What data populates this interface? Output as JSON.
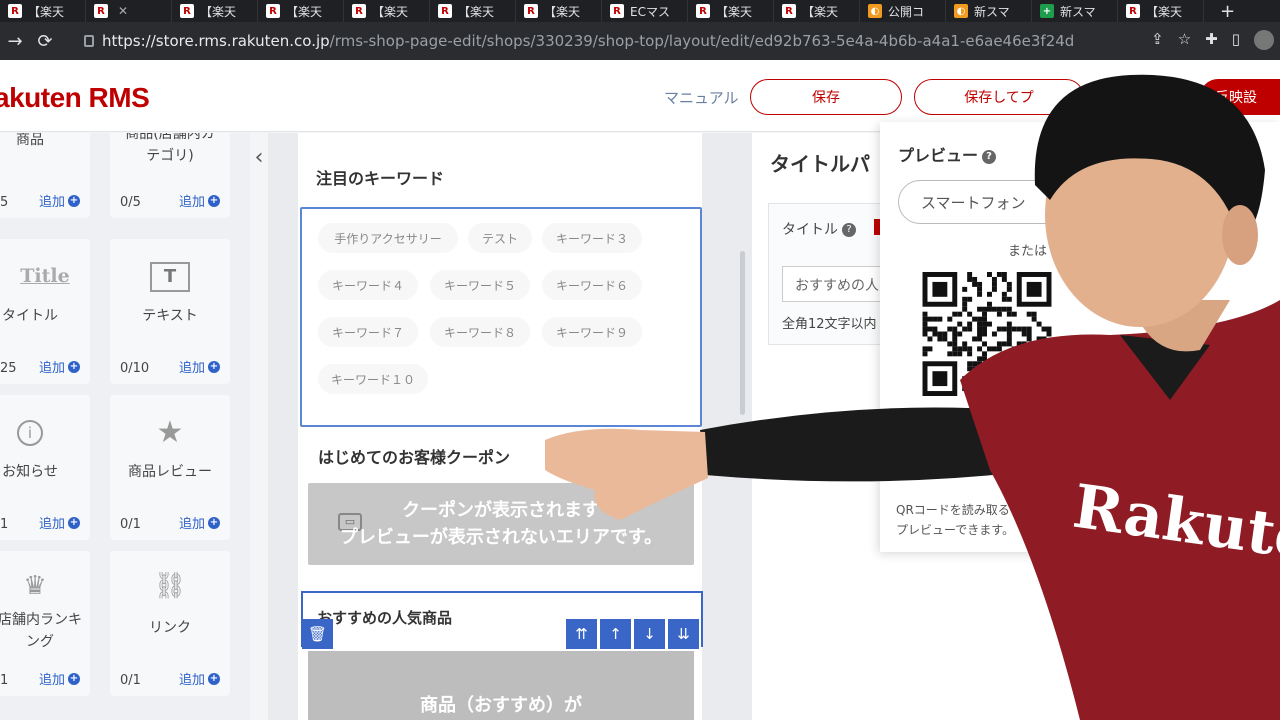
{
  "browser": {
    "tabs": [
      {
        "icon": "rakuten-icon",
        "label": "【楽天"
      },
      {
        "icon": "rakuten-icon",
        "label": "",
        "close": "✕"
      },
      {
        "icon": "rakuten-icon",
        "label": "【楽天"
      },
      {
        "icon": "rakuten-icon",
        "label": "【楽天"
      },
      {
        "icon": "rakuten-icon",
        "label": "【楽天"
      },
      {
        "icon": "rakuten-icon",
        "label": "【楽天"
      },
      {
        "icon": "rakuten-icon",
        "label": "【楽天"
      },
      {
        "icon": "rakuten-icon",
        "label": "ECマス"
      },
      {
        "icon": "rakuten-icon",
        "label": "【楽天"
      },
      {
        "icon": "rakuten-icon",
        "label": "【楽天"
      },
      {
        "icon": "orange-icon",
        "label": "公開コ"
      },
      {
        "icon": "orange-icon",
        "label": "新スマ"
      },
      {
        "icon": "green-plus-icon",
        "label": "新スマ"
      },
      {
        "icon": "rakuten-icon",
        "label": "【楽天"
      }
    ],
    "new_tab": "+",
    "url_host": "https://store.rms.rakuten.co.jp",
    "url_path": "/rms-shop-page-edit/shops/330239/shop-top/layout/edit/ed92b763-5e4a-4b6b-a4a1-e6ae46e3f24d"
  },
  "header": {
    "logo": "akuten RMS",
    "manual": "マニュアル",
    "save": "保存",
    "save_preview": "保存してプ",
    "publish": "反映設"
  },
  "palette": {
    "top_row": [
      {
        "label": "商品",
        "count": "5",
        "add": "追加"
      },
      {
        "label": "商品(店舗内カ\nテゴリ)",
        "count": "0/5",
        "add": "追加"
      }
    ],
    "widgets": [
      {
        "icon": "Title",
        "label": "タイトル",
        "count": "25",
        "add": "追加"
      },
      {
        "icon": "T",
        "label": "テキスト",
        "count": "0/10",
        "add": "追加"
      },
      {
        "icon": "i",
        "label": "お知らせ",
        "count": "1",
        "add": "追加"
      },
      {
        "icon": "★",
        "label": "商品レビュー",
        "count": "0/1",
        "add": "追加"
      },
      {
        "icon": "♛",
        "label": "店舗内ランキ\nング",
        "count": "1",
        "add": "追加"
      },
      {
        "icon": "⛓",
        "label": "リンク",
        "count": "0/1",
        "add": "追加"
      }
    ],
    "collapse": "‹"
  },
  "canvas": {
    "keywords_title": "注目のキーワード",
    "keywords": [
      "手作りアクセサリー",
      "テスト",
      "キーワード３",
      "キーワード４",
      "キーワード５",
      "キーワード６",
      "キーワード７",
      "キーワード８",
      "キーワード９",
      "キーワード１０"
    ],
    "coupon_title": "はじめてのお客様クーポン",
    "coupon_message": "クーポンが表示されます\nプレビューが表示されないエリアです。",
    "recommend_title": "おすすめの人気商品",
    "recommend_image_text": "商品（おすすめ）が",
    "toolbar": {
      "delete": "🗑",
      "top": "⇈",
      "up": "↑",
      "down": "↓",
      "bottom": "⇊"
    }
  },
  "settings": {
    "title": "タイトルパ",
    "field_label": "タイトル",
    "field_value": "おすすめの人",
    "field_hint": "全角12文字以内"
  },
  "preview": {
    "title": "プレビュー",
    "device_button": "スマートフォン",
    "or_text": "または",
    "note": "QRコードを読み取ると、楽天\nプレビューできます。"
  },
  "colors": {
    "brand": "#bf0000",
    "link": "#2f62c9",
    "selection": "#3a67c7"
  }
}
